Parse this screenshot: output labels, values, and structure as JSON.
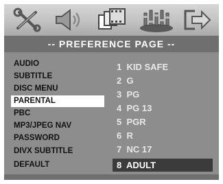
{
  "icons": [
    "wrench-screwdriver-icon",
    "speaker-icon",
    "video-frames-icon",
    "preferences-icon",
    "exit-arrow-icon"
  ],
  "banner": {
    "title": "-- PREFERENCE PAGE --"
  },
  "menu": {
    "items": [
      "AUDIO",
      "SUBTITLE",
      "DISC MENU",
      "PARENTAL",
      "PBC",
      "MP3/JPEG NAV",
      "PASSWORD",
      "DIVX SUBTITLE",
      "DEFAULT"
    ],
    "selected": "PARENTAL"
  },
  "options": {
    "items": [
      "1  KID SAFE",
      "2  G",
      "3  PG",
      "4  PG 13",
      "5  PGR",
      "6  R",
      "7  NC 17",
      "8  ADULT"
    ],
    "selected": "8  ADULT"
  },
  "colors": {
    "icon_bar": "#c8c8c8",
    "banner": "#6f6f6f",
    "panel": "#8d8d8d",
    "highlight_menu": "#ffffff",
    "highlight_option": "#3b3b3b"
  }
}
